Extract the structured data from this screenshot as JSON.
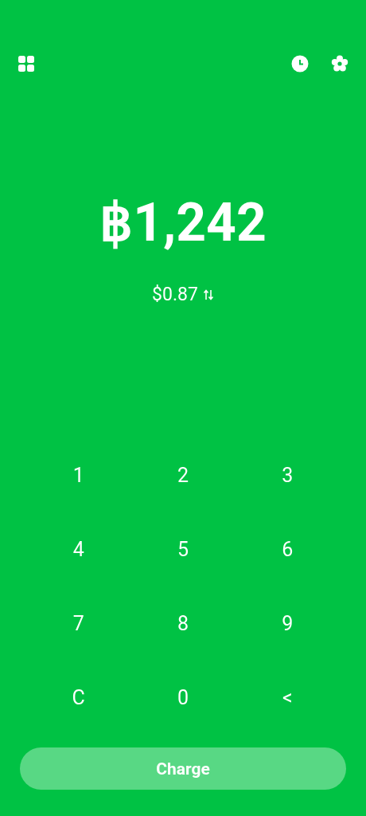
{
  "amount": "฿1,242",
  "fiat_amount": "$0.87",
  "keypad": [
    "1",
    "2",
    "3",
    "4",
    "5",
    "6",
    "7",
    "8",
    "9",
    "C",
    "0",
    "<"
  ],
  "charge_button": {
    "label": "Charge",
    "disabled": true
  }
}
